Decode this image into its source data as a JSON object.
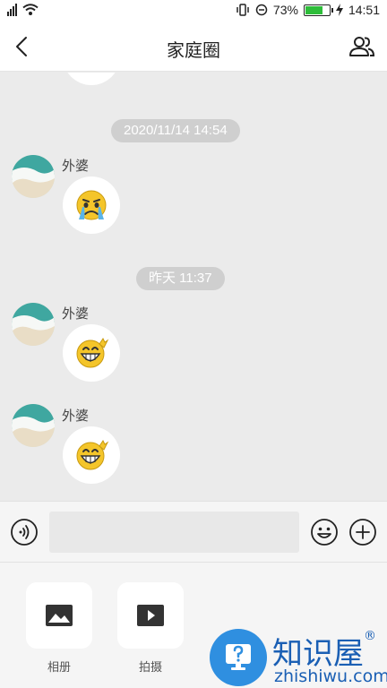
{
  "status_bar": {
    "battery": "73%",
    "time": "14:51",
    "battery_level": 0.73,
    "battery_color": "#2ebd3a"
  },
  "header": {
    "title": "家庭圈"
  },
  "messages": [
    {
      "timestamp": "2020/11/14 14:54",
      "sender": "外婆",
      "sticker": "crying-emoji"
    },
    {
      "timestamp": "昨天 11:37",
      "sender": "外婆",
      "sticker": "grinning-emoji"
    },
    {
      "sender": "外婆",
      "sticker": "grinning-emoji"
    }
  ],
  "input": {
    "placeholder": ""
  },
  "tools": [
    {
      "label": "相册",
      "icon": "image-icon"
    },
    {
      "label": "拍摄",
      "icon": "video-icon"
    }
  ],
  "watermark": {
    "text": "知识屋",
    "registered": "®",
    "site": "zhishiwu.com"
  }
}
